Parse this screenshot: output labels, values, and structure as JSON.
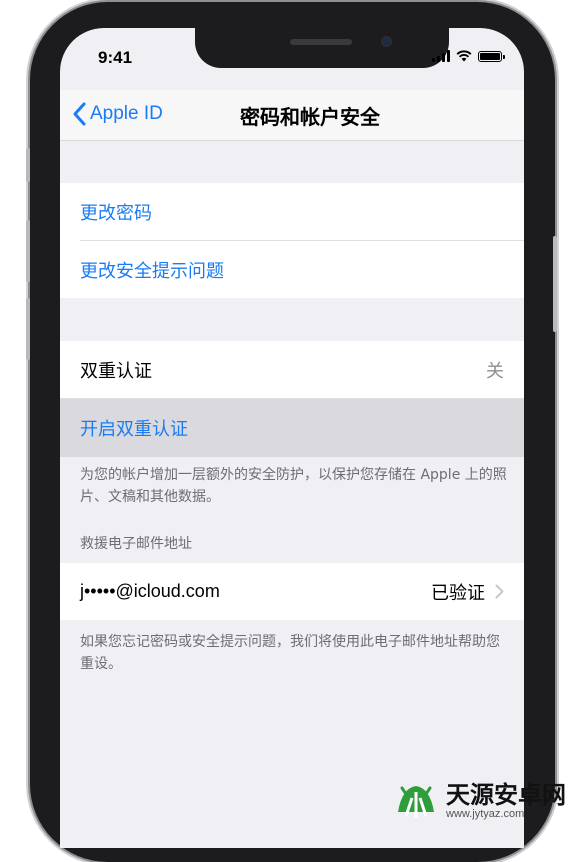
{
  "status_bar": {
    "time": "9:41"
  },
  "nav": {
    "back_label": "Apple ID",
    "title": "密码和帐户安全"
  },
  "section1": {
    "items": [
      "更改密码",
      "更改安全提示问题"
    ]
  },
  "two_factor": {
    "label": "双重认证",
    "value": "关",
    "enable_label": "开启双重认证",
    "footer": "为您的帐户增加一层额外的安全防护，以保护您存储在 Apple 上的照片、文稿和其他数据。"
  },
  "rescue_email": {
    "header": "救援电子邮件地址",
    "email": "j•••••@icloud.com",
    "status": "已验证",
    "footer": "如果您忘记密码或安全提示问题，我们将使用此电子邮件地址帮助您重设。"
  },
  "watermark": {
    "title": "天源安卓网",
    "url": "www.jytyaz.com"
  }
}
